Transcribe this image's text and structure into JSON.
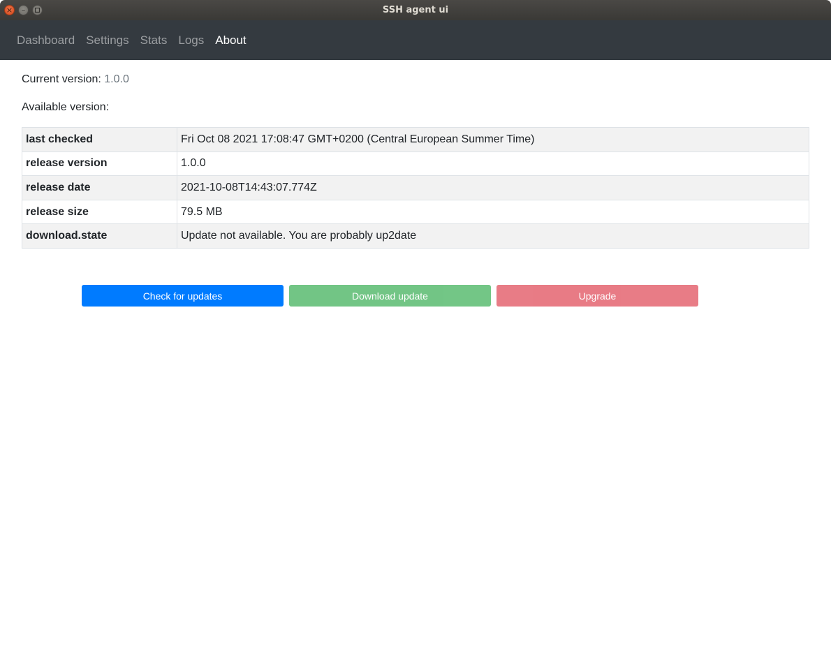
{
  "window": {
    "title": "SSH agent ui",
    "close_icon": "×",
    "minimize_icon": "–"
  },
  "nav": {
    "items": [
      {
        "label": "Dashboard",
        "active": false
      },
      {
        "label": "Settings",
        "active": false
      },
      {
        "label": "Stats",
        "active": false
      },
      {
        "label": "Logs",
        "active": false
      },
      {
        "label": "About",
        "active": true
      }
    ]
  },
  "about": {
    "current_version_label": "Current version:",
    "current_version_value": "1.0.0",
    "available_version_label": "Available version:",
    "rows": [
      {
        "key": "last checked",
        "value": "Fri Oct 08 2021 17:08:47 GMT+0200 (Central European Summer Time)"
      },
      {
        "key": "release version",
        "value": "1.0.0"
      },
      {
        "key": "release date",
        "value": "2021-10-08T14:43:07.774Z"
      },
      {
        "key": "release size",
        "value": "79.5 MB"
      },
      {
        "key": "download.state",
        "value": "Update not available. You are probably up2date"
      }
    ]
  },
  "actions": {
    "check_label": "Check for updates",
    "download_label": "Download update",
    "upgrade_label": "Upgrade"
  },
  "colors": {
    "navbar": "#343a40",
    "primary": "#007bff",
    "success": "#28a745",
    "danger": "#dc3545"
  }
}
